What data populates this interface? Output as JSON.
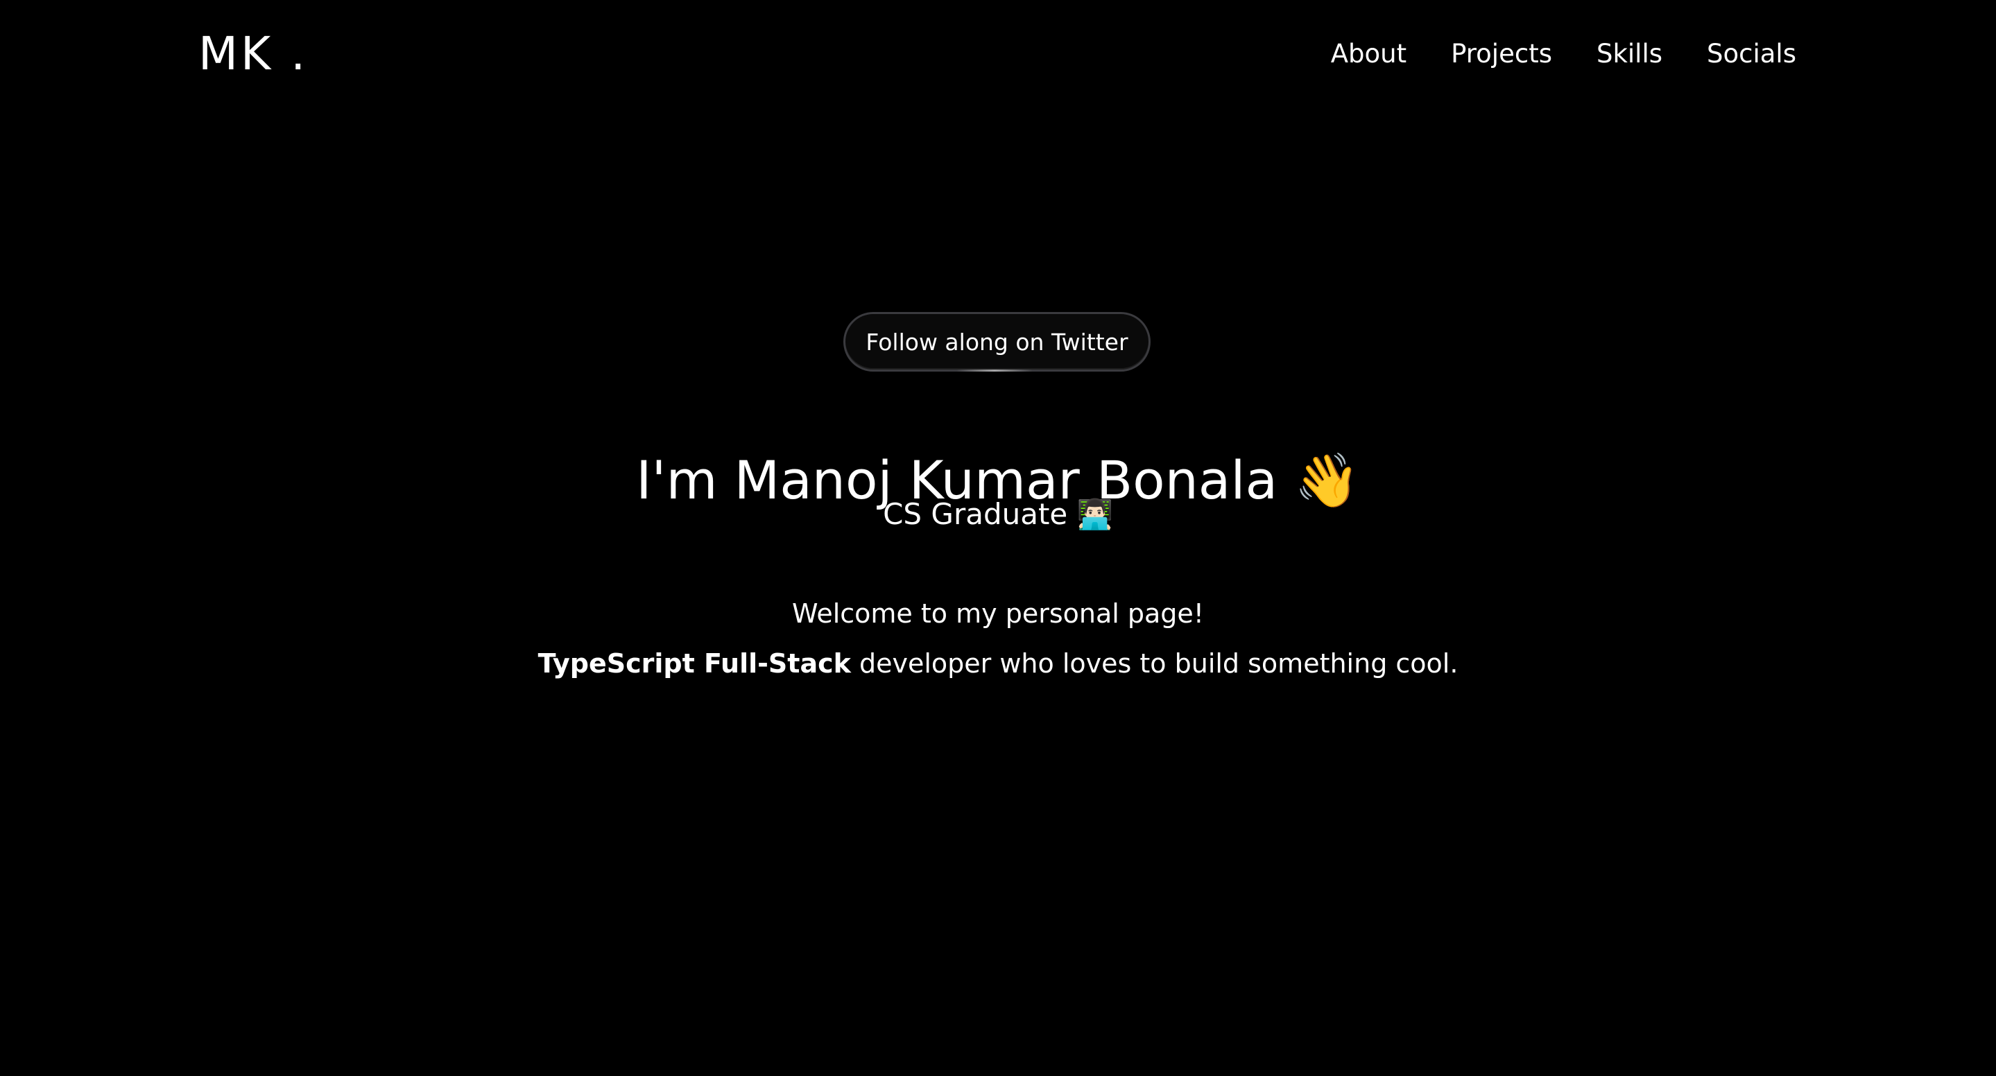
{
  "header": {
    "logo": "MK .",
    "nav": [
      {
        "label": "About"
      },
      {
        "label": "Projects"
      },
      {
        "label": "Skills"
      },
      {
        "label": "Socials"
      }
    ]
  },
  "hero": {
    "twitter_button_label": "Follow along on Twitter",
    "title": "I'm Manoj Kumar Bonala",
    "title_emoji": "👋",
    "subtitle": "CS Graduate",
    "subtitle_emoji": "👨🏻‍💻",
    "welcome": "Welcome to my personal page!",
    "tagline_highlight": "TypeScript Full-Stack",
    "tagline_rest": " developer who loves to build something cool."
  },
  "colors": {
    "background": "#000000",
    "text": "#ffffff",
    "pill_border": "#3a3a3e"
  }
}
